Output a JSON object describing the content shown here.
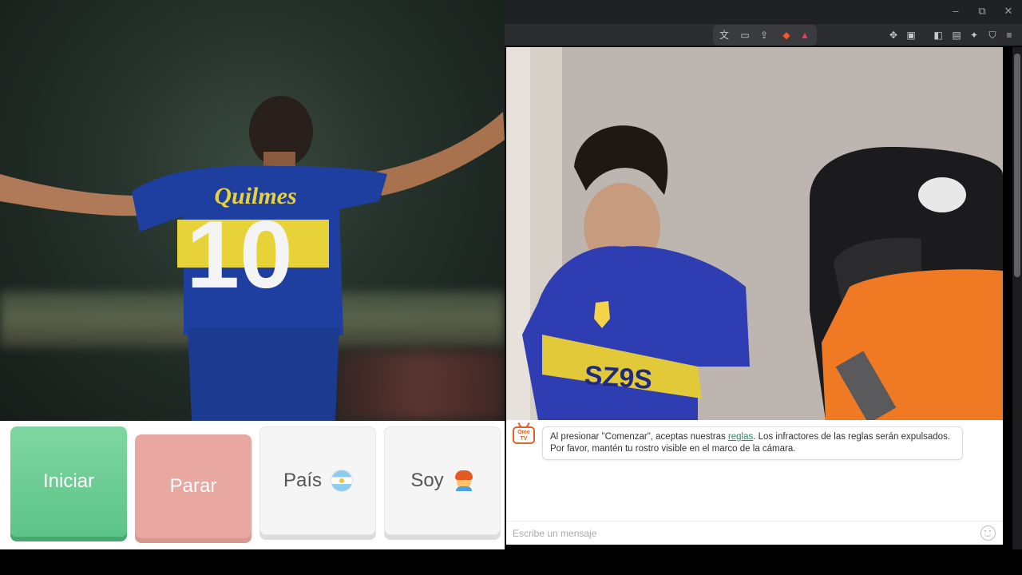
{
  "window": {
    "minimize": "–",
    "restore": "⧉",
    "close": "✕"
  },
  "toolbar": {
    "icons": [
      "translate-icon",
      "cast-icon",
      "share-icon",
      "brave-shields-icon",
      "brave-rewards-icon",
      "extensions-icon",
      "screenshot-icon",
      "sidebar-icon",
      "wallet-icon",
      "leo-ai-icon",
      "vpn-icon",
      "menu-icon"
    ]
  },
  "controls": {
    "start_label": "Iniciar",
    "stop_label": "Parar",
    "country_label": "País",
    "gender_label": "Soy",
    "colors": {
      "start": "#5cc488",
      "stop": "#e8a7a0",
      "neutral": "#f5f5f5"
    }
  },
  "chat": {
    "logo_text": "Ome TV",
    "message_before_link": "Al presionar \"Comenzar\", aceptas nuestras ",
    "message_link": "reglas",
    "message_after_link": ". Los infractores de las reglas serán expulsados. Por favor, mantén tu rostro visible en el marco de la cámara.",
    "input_placeholder": "Escribe un mensaje"
  }
}
